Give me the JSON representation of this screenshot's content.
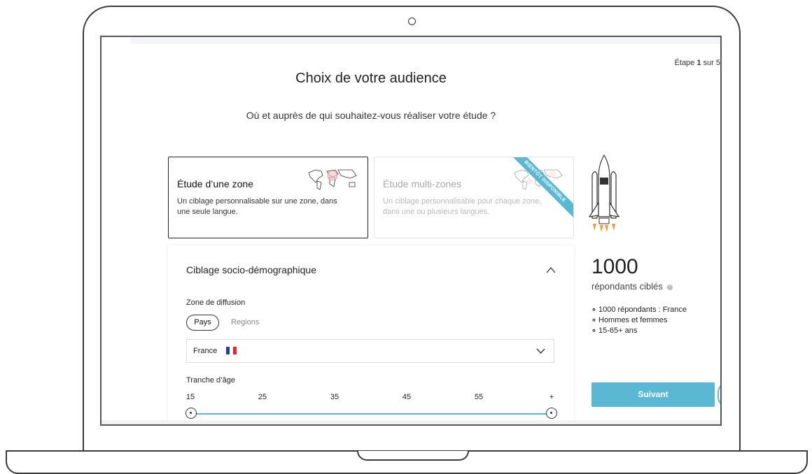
{
  "header": {
    "step_prefix": "Étape ",
    "step_current": "1",
    "step_suffix": " sur 5",
    "title": "Choix de votre audience",
    "subtitle": "Où et auprès de qui souhaitez-vous réaliser votre étude ?"
  },
  "study_options": [
    {
      "title": "Étude d’une zone",
      "description": "Un ciblage personnalisable sur une zone, dans une seule langue.",
      "selected": true,
      "icon": "world-map-icon"
    },
    {
      "title": "Étude multi-zones",
      "description": "Un ciblage personnalisable pour chaque zone, dans une ou plusieurs langues.",
      "selected": false,
      "ribbon": "BIENTÔT DISPONIBLE",
      "icon": "world-map-icon"
    }
  ],
  "targeting": {
    "section_title": "Ciblage socio-démographique",
    "zone_label": "Zone de diffusion",
    "zone_tabs": [
      "Pays",
      "Regions"
    ],
    "active_zone_tab": "Pays",
    "country": "France",
    "country_flag_colors": [
      "#1f3fa6",
      "#ffffff",
      "#e1262d"
    ],
    "age_label": "Tranche d’âge",
    "age_ticks": [
      "15",
      "25",
      "35",
      "45",
      "55",
      "+"
    ],
    "age_range": [
      "15",
      "+"
    ]
  },
  "summary": {
    "count": "1000",
    "count_label": "répondants ciblés",
    "info_icon": "info-icon",
    "bullets": [
      "1000 répondants : France",
      "Hommes et femmes",
      "15-65+ ans"
    ],
    "next_label": "Suivant"
  },
  "colors": {
    "accent": "#5ab8d4",
    "rocket_flame": "#f39a3b"
  }
}
